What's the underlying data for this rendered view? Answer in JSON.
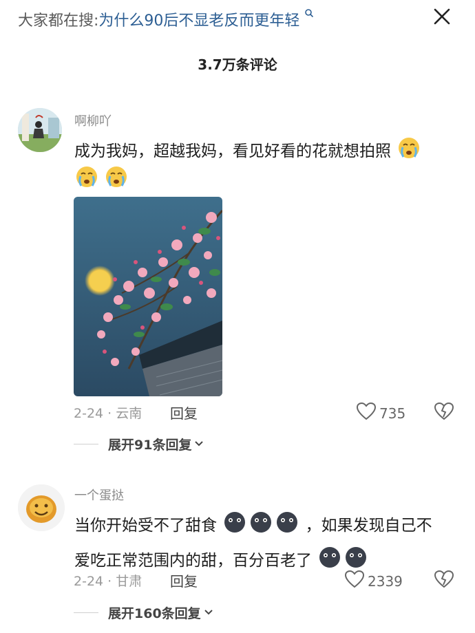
{
  "header": {
    "search_prefix": "大家都在搜:",
    "search_query": "为什么90后不显老反而更年轻",
    "comment_count": "3.7万条评论"
  },
  "comments": [
    {
      "username": "啊柳吖",
      "text": "成为我妈，超越我妈，看见好看的花就想拍照",
      "date_location": "2-24 · 云南",
      "reply_label": "回复",
      "likes": "735",
      "expand_label": "展开91条回复",
      "emoji": "crying-face",
      "emoji_count": 3
    },
    {
      "username": "一个蛋挞",
      "text_line1_a": "当你开始受不了甜食",
      "text_line1_b": "，如果发现自己不",
      "text_line2": "爱吃正常范围内的甜，百分百老了",
      "date_location": "2-24 · 甘肃",
      "reply_label": "回复",
      "likes": "2339",
      "expand_label": "展开160条回复",
      "emoji": "dark-blob-face",
      "emoji_count": 5
    }
  ]
}
